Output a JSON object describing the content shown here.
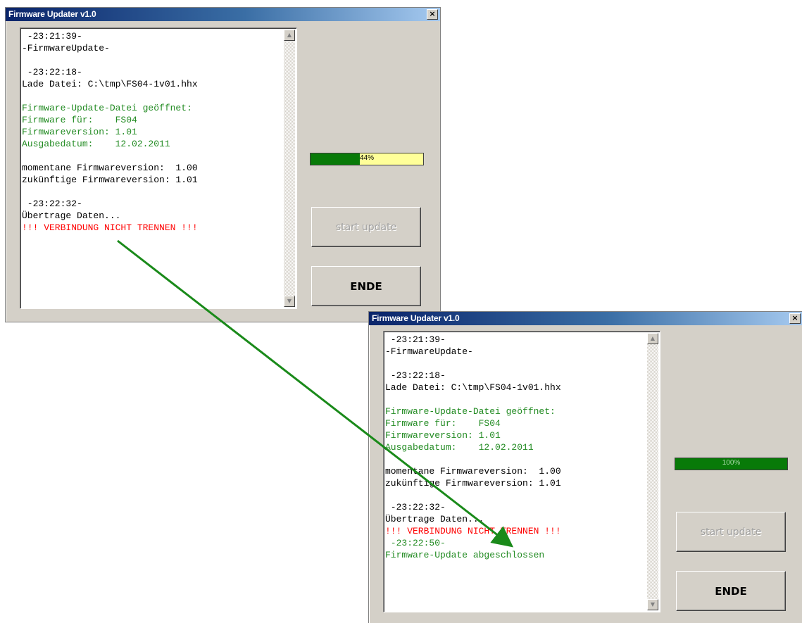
{
  "windows": [
    {
      "title": "Firmware Updater v1.0",
      "close_label": "×",
      "log_lines": [
        {
          "text": " -23:21:39-",
          "color": "black"
        },
        {
          "text": "-FirmwareUpdate-",
          "color": "black"
        },
        {
          "text": "",
          "color": "black"
        },
        {
          "text": " -23:22:18-",
          "color": "black"
        },
        {
          "text": "Lade Datei: C:\\tmp\\FS04-1v01.hhx",
          "color": "black"
        },
        {
          "text": "",
          "color": "black"
        },
        {
          "text": "Firmware-Update-Datei geöffnet:",
          "color": "green"
        },
        {
          "text": "Firmware für:    FS04",
          "color": "green"
        },
        {
          "text": "Firmwareversion: 1.01",
          "color": "green"
        },
        {
          "text": "Ausgabedatum:    12.02.2011",
          "color": "green"
        },
        {
          "text": "",
          "color": "black"
        },
        {
          "text": "momentane Firmwareversion:  1.00",
          "color": "black"
        },
        {
          "text": "zukünftige Firmwareversion: 1.01",
          "color": "black"
        },
        {
          "text": "",
          "color": "black"
        },
        {
          "text": " -23:22:32-",
          "color": "black"
        },
        {
          "text": "Übertrage Daten...",
          "color": "black"
        },
        {
          "text": "!!! VERBINDUNG NICHT TRENNEN !!!",
          "color": "red"
        }
      ],
      "progress": {
        "percent": 44,
        "label": "44%"
      },
      "start_button": "start update",
      "end_button": "ENDE"
    },
    {
      "title": "Firmware Updater v1.0",
      "close_label": "×",
      "log_lines": [
        {
          "text": " -23:21:39-",
          "color": "black"
        },
        {
          "text": "-FirmwareUpdate-",
          "color": "black"
        },
        {
          "text": "",
          "color": "black"
        },
        {
          "text": " -23:22:18-",
          "color": "black"
        },
        {
          "text": "Lade Datei: C:\\tmp\\FS04-1v01.hhx",
          "color": "black"
        },
        {
          "text": "",
          "color": "black"
        },
        {
          "text": "Firmware-Update-Datei geöffnet:",
          "color": "green"
        },
        {
          "text": "Firmware für:    FS04",
          "color": "green"
        },
        {
          "text": "Firmwareversion: 1.01",
          "color": "green"
        },
        {
          "text": "Ausgabedatum:    12.02.2011",
          "color": "green"
        },
        {
          "text": "",
          "color": "black"
        },
        {
          "text": "momentane Firmwareversion:  1.00",
          "color": "black"
        },
        {
          "text": "zukünftige Firmwareversion: 1.01",
          "color": "black"
        },
        {
          "text": "",
          "color": "black"
        },
        {
          "text": " -23:22:32-",
          "color": "black"
        },
        {
          "text": "Übertrage Daten...",
          "color": "black"
        },
        {
          "text": "!!! VERBINDUNG NICHT TRENNEN !!!",
          "color": "red"
        },
        {
          "text": " -23:22:50-",
          "color": "green"
        },
        {
          "text": "Firmware-Update abgeschlossen",
          "color": "green"
        }
      ],
      "progress": {
        "percent": 100,
        "label": "100%"
      },
      "start_button": "start update",
      "end_button": "ENDE"
    }
  ],
  "annotation": {
    "arrow_color": "#1a8a1a"
  },
  "icons": {
    "scroll_up": "scroll-up-arrow-icon",
    "scroll_down": "scroll-down-arrow-icon"
  }
}
